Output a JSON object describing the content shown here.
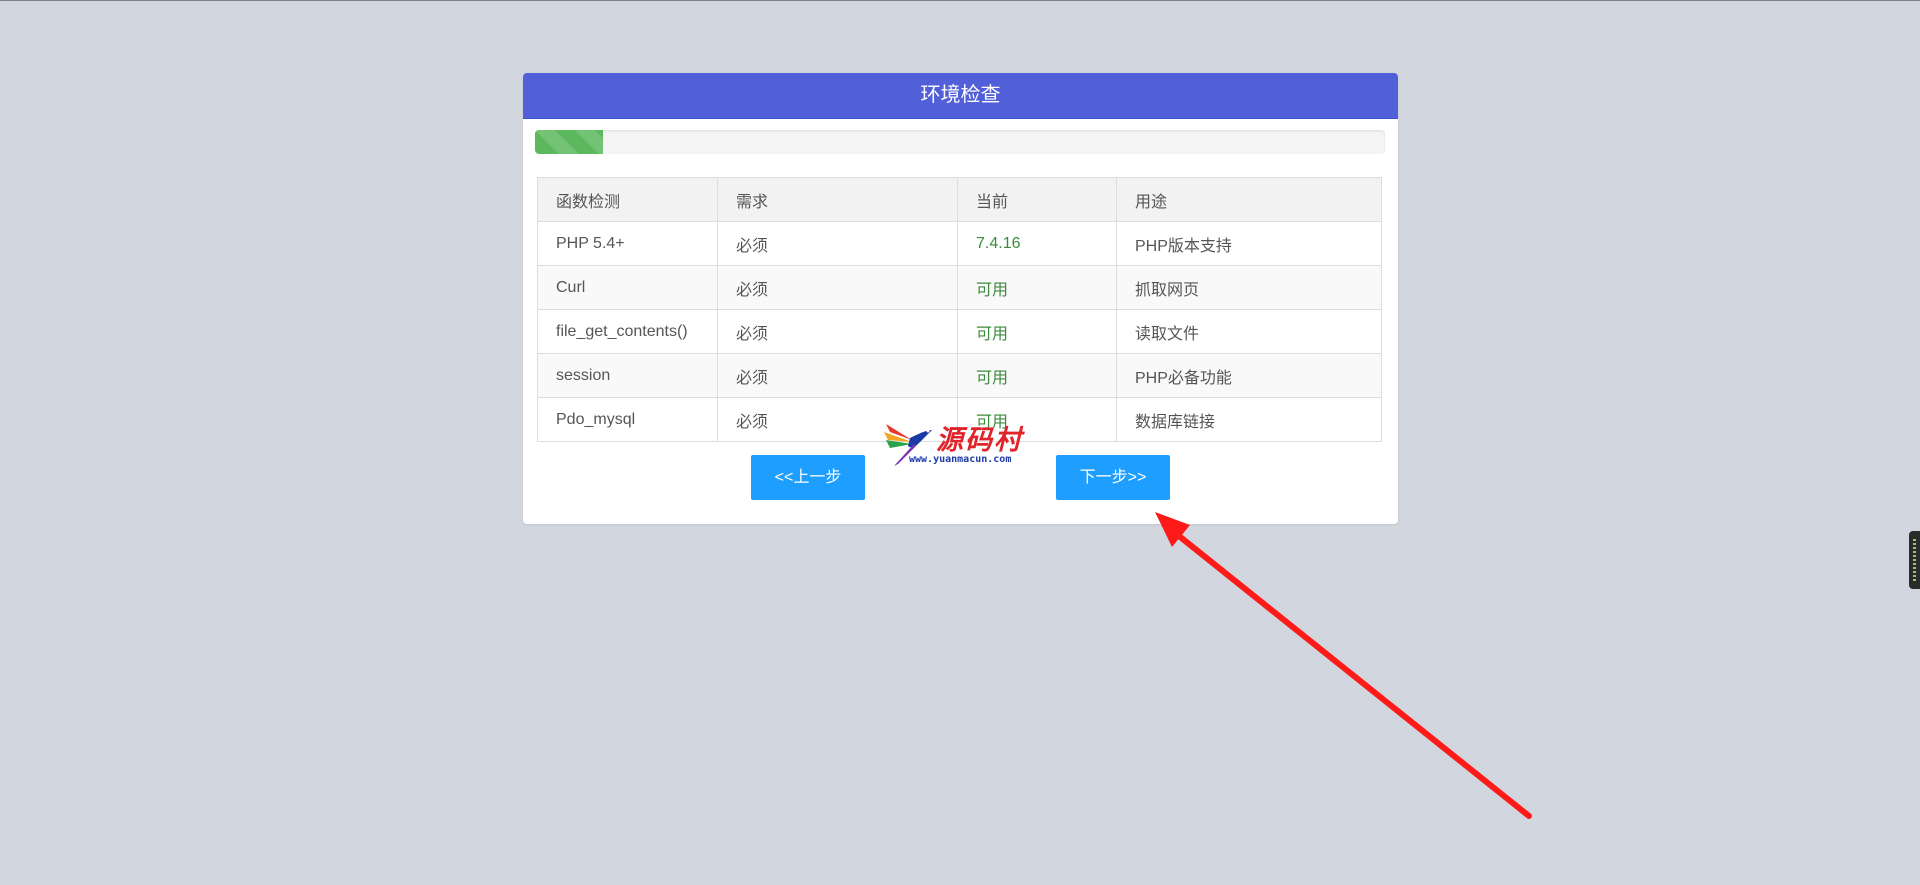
{
  "header": {
    "title": "环境检查"
  },
  "progress": {
    "fraction": 0.08,
    "color": "#5cb85c"
  },
  "table": {
    "columns": [
      "函数检测",
      "需求",
      "当前",
      "用途"
    ],
    "rows": [
      {
        "name": "PHP 5.4+",
        "requirement": "必须",
        "current": "7.4.16",
        "purpose": "PHP版本支持"
      },
      {
        "name": "Curl",
        "requirement": "必须",
        "current": "可用",
        "purpose": "抓取网页"
      },
      {
        "name": "file_get_contents()",
        "requirement": "必须",
        "current": "可用",
        "purpose": "读取文件"
      },
      {
        "name": "session",
        "requirement": "必须",
        "current": "可用",
        "purpose": "PHP必备功能"
      },
      {
        "name": "Pdo_mysql",
        "requirement": "必须",
        "current": "可用",
        "purpose": "数据库链接"
      }
    ]
  },
  "buttons": {
    "prev_label": "<<上一步",
    "next_label": "下一步>>"
  },
  "watermark": {
    "text": "源码村",
    "url": "www.yuanmacun.com"
  },
  "colors": {
    "header_bg": "#5160d8",
    "button_bg": "#1e9fff",
    "ok_text": "#3c8a3c",
    "arrow": "#ff1a1a",
    "page_bg": "#d2d6df"
  },
  "icons": {
    "annotation_arrow": "arrow-icon",
    "watermark_bird": "bird-logo-icon"
  }
}
